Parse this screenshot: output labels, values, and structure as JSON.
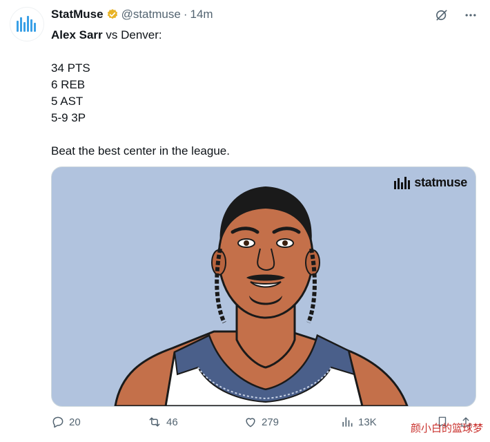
{
  "tweet": {
    "display_name": "StatMuse",
    "handle": "@statmuse",
    "separator": "·",
    "time": "14m",
    "text": {
      "player": "Alex Sarr",
      "opponent": " vs Denver:",
      "stats": [
        "34 PTS",
        "6 REB",
        "5 AST",
        "5-9 3P"
      ],
      "closing": "Beat the best center in the league."
    },
    "media": {
      "logo_text": "statmuse",
      "background_color": "#b1c3de"
    }
  },
  "actions": {
    "replies": "20",
    "retweets": "46",
    "likes": "279",
    "views": "13K"
  },
  "watermark": "颜小白的篮球梦",
  "colors": {
    "verified": "#e8b326",
    "text_secondary": "#536471",
    "accent": "#1d9bf0"
  },
  "icons": [
    "statmuse-logo-icon",
    "verified-badge-icon",
    "grok-icon",
    "more-icon",
    "reply-icon",
    "retweet-icon",
    "like-icon",
    "views-icon",
    "bookmark-icon",
    "share-icon"
  ]
}
